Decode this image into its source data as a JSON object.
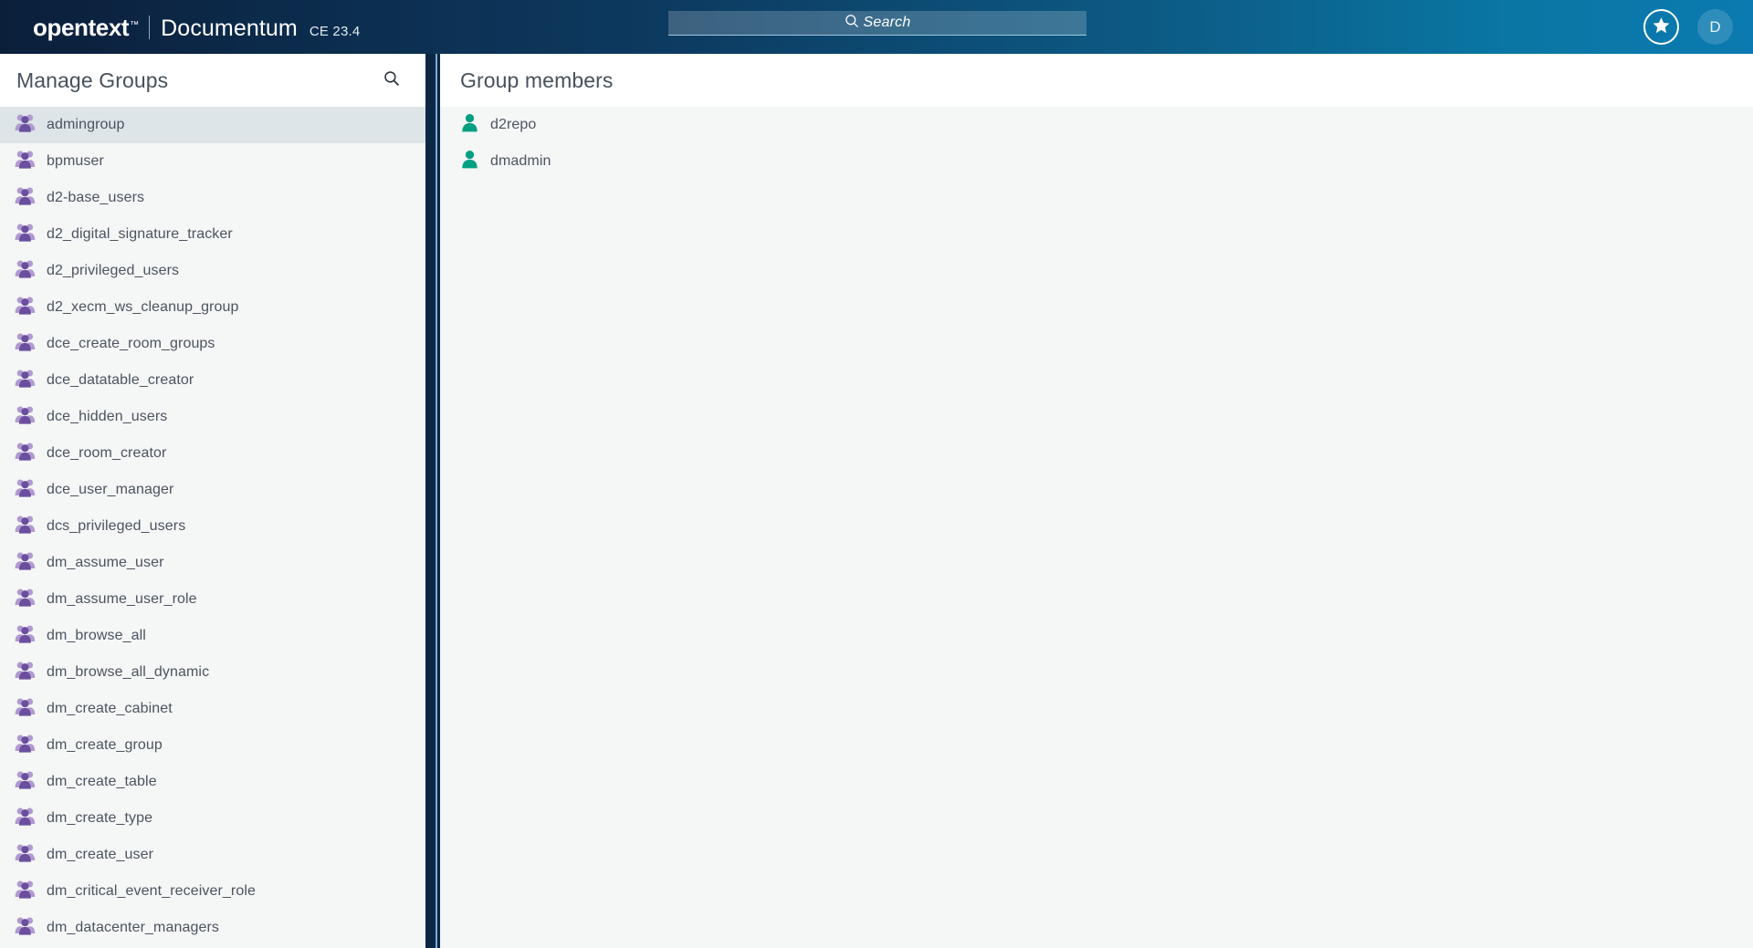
{
  "header": {
    "brand": "opentext",
    "brand_tm": "™",
    "product": "Documentum",
    "version": "CE 23.4",
    "search_placeholder": "Search",
    "search_icon": "search-icon",
    "favorites_icon": "star-icon",
    "avatar_initial": "D",
    "gradient_from": "#0b1f3a",
    "gradient_to": "#0a7ab0"
  },
  "left_panel": {
    "title": "Manage Groups",
    "search_icon": "search-icon",
    "group_icon": "group-users-icon",
    "selected_index": 0,
    "groups": [
      {
        "name": "admingroup"
      },
      {
        "name": "bpmuser"
      },
      {
        "name": "d2-base_users"
      },
      {
        "name": "d2_digital_signature_tracker"
      },
      {
        "name": "d2_privileged_users"
      },
      {
        "name": "d2_xecm_ws_cleanup_group"
      },
      {
        "name": "dce_create_room_groups"
      },
      {
        "name": "dce_datatable_creator"
      },
      {
        "name": "dce_hidden_users"
      },
      {
        "name": "dce_room_creator"
      },
      {
        "name": "dce_user_manager"
      },
      {
        "name": "dcs_privileged_users"
      },
      {
        "name": "dm_assume_user"
      },
      {
        "name": "dm_assume_user_role"
      },
      {
        "name": "dm_browse_all"
      },
      {
        "name": "dm_browse_all_dynamic"
      },
      {
        "name": "dm_create_cabinet"
      },
      {
        "name": "dm_create_group"
      },
      {
        "name": "dm_create_table"
      },
      {
        "name": "dm_create_type"
      },
      {
        "name": "dm_create_user"
      },
      {
        "name": "dm_critical_event_receiver_role"
      },
      {
        "name": "dm_datacenter_managers"
      }
    ]
  },
  "right_panel": {
    "title": "Group members",
    "member_icon": "person-icon",
    "member_icon_color": "#00a080",
    "members": [
      {
        "name": "d2repo"
      },
      {
        "name": "dmadmin"
      }
    ]
  }
}
